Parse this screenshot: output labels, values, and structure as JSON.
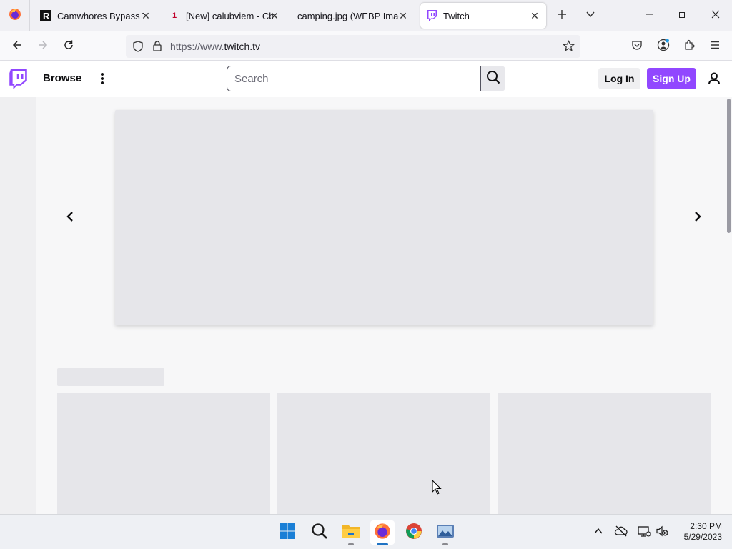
{
  "browser": {
    "tabs": [
      {
        "title": "Camwhores Bypass Too",
        "favicon": "letter-r-icon"
      },
      {
        "title": "[New] calubviem - Cbo",
        "badge": "1"
      },
      {
        "title": "camping.jpg (WEBP Image",
        "favicon": "none"
      },
      {
        "title": "Twitch",
        "favicon": "twitch-icon",
        "active": true
      }
    ],
    "url_prefix": "https://www.",
    "url_domain": "twitch.tv"
  },
  "twitch": {
    "browse_label": "Browse",
    "search_placeholder": "Search",
    "login_label": "Log In",
    "signup_label": "Sign Up",
    "brand_color": "#9147ff"
  },
  "taskbar": {
    "time": "2:30 PM",
    "date": "5/29/2023"
  }
}
